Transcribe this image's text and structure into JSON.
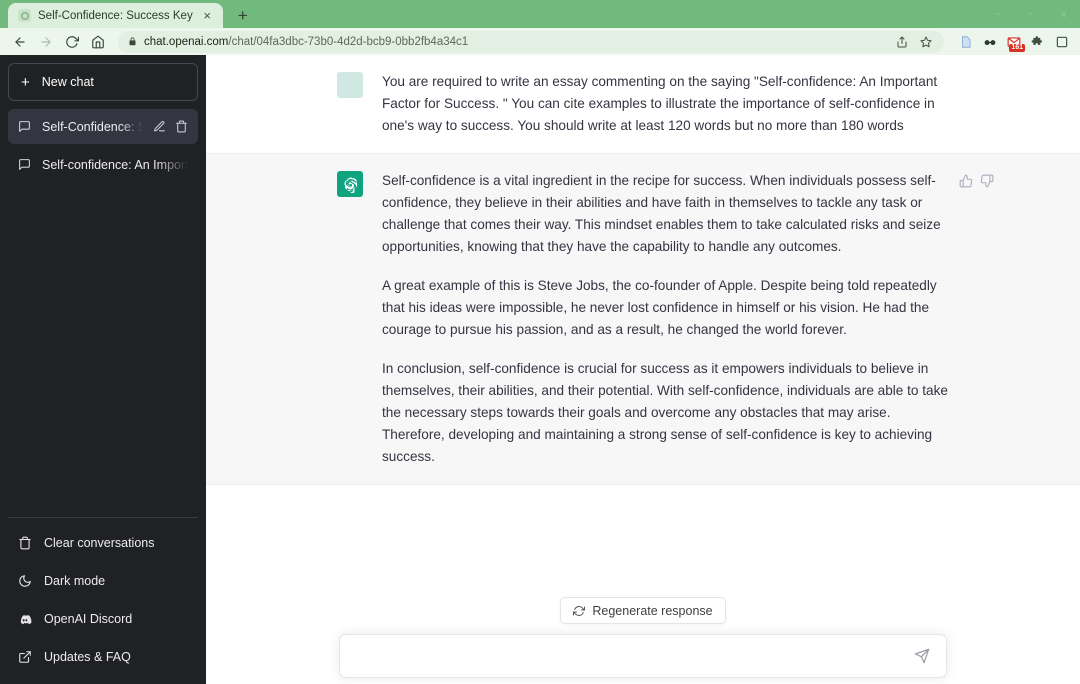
{
  "browser": {
    "tab": {
      "title": "Self-Confidence: Success Key",
      "close_label": "×",
      "favicon_name": "chatgpt-favicon"
    },
    "new_tab_label": "+",
    "window_controls": [
      {
        "name": "minimize",
        "glyph": "–"
      },
      {
        "name": "maximize",
        "glyph": "▫"
      },
      {
        "name": "close",
        "glyph": "✕"
      }
    ],
    "nav": {
      "back": "back-icon",
      "forward": "forward-icon",
      "reload": "reload-icon",
      "home": "home-icon"
    },
    "omnibox": {
      "lock": "lock-icon",
      "url_host": "chat.openai.com",
      "url_path": "/chat/04fa3dbc-73b0-4d2d-bcb9-0bb2fb4a34c1",
      "url_full": "chat.openai.com/chat/04fa3dbc-73b0-4d2d-bcb9-0bb2fb4a34c1",
      "share_icon": "share-icon",
      "bookmark_icon": "star-icon"
    },
    "extensions": [
      {
        "name": "reading-list-icon",
        "badge": ""
      },
      {
        "name": "glasses-extension-icon",
        "badge": ""
      },
      {
        "name": "gmail-extension-icon",
        "badge": "161"
      },
      {
        "name": "extensions-puzzle-icon",
        "badge": ""
      },
      {
        "name": "profile-icon",
        "badge": ""
      }
    ]
  },
  "sidebar": {
    "new_chat_label": "New chat",
    "new_chat_plus": "+",
    "conversations": [
      {
        "title": "Self-Confidence: Success Key",
        "active": true
      },
      {
        "title": "Self-confidence: An Important Factor",
        "active": false
      }
    ],
    "conversation_actions": [
      {
        "name": "edit-conversation-icon"
      },
      {
        "name": "delete-conversation-icon"
      }
    ],
    "bottom_items": [
      {
        "label": "Clear conversations",
        "icon": "trash-icon"
      },
      {
        "label": "Dark mode",
        "icon": "moon-icon"
      },
      {
        "label": "OpenAI Discord",
        "icon": "discord-icon"
      },
      {
        "label": "Updates & FAQ",
        "icon": "external-link-icon"
      }
    ]
  },
  "conversation": {
    "user_message": {
      "avatar_name": "user-avatar",
      "text": "You are required to write an essay commenting on the saying \"Self-confidence: An Important Factor for Success. \" You can cite examples to illustrate the importance of self-confidence in one's way to success. You should write at least 120 words but no more than 180 words"
    },
    "assistant_message": {
      "avatar_name": "chatgpt-avatar",
      "paragraphs": [
        "Self-confidence is a vital ingredient in the recipe for success. When individuals possess self-confidence, they believe in their abilities and have faith in themselves to tackle any task or challenge that comes their way. This mindset enables them to take calculated risks and seize opportunities, knowing that they have the capability to handle any outcomes.",
        "A great example of this is Steve Jobs, the co-founder of Apple. Despite being told repeatedly that his ideas were impossible, he never lost confidence in himself or his vision. He had the courage to pursue his passion, and as a result, he changed the world forever.",
        "In conclusion, self-confidence is crucial for success as it empowers individuals to believe in themselves, their abilities, and their potential. With self-confidence, individuals are able to take the necessary steps towards their goals and overcome any obstacles that may arise. Therefore, developing and maintaining a strong sense of self-confidence is key to achieving success."
      ],
      "feedback": [
        {
          "name": "thumbs-up-icon"
        },
        {
          "name": "thumbs-down-icon"
        }
      ]
    }
  },
  "composer": {
    "regenerate_label": "Regenerate response",
    "regenerate_icon": "refresh-icon",
    "input_value": "",
    "input_placeholder": "",
    "send_icon": "send-icon"
  },
  "colors": {
    "chrome_green": "#71b97c",
    "toolbar_mint": "#edf6ed",
    "sidebar_dark": "#202123",
    "sidebar_active": "#343541",
    "assistant_bg": "#f7f7f8",
    "accent_teal": "#10a37f",
    "user_avatar": "#cfe9e2",
    "badge_red": "#d93025"
  }
}
